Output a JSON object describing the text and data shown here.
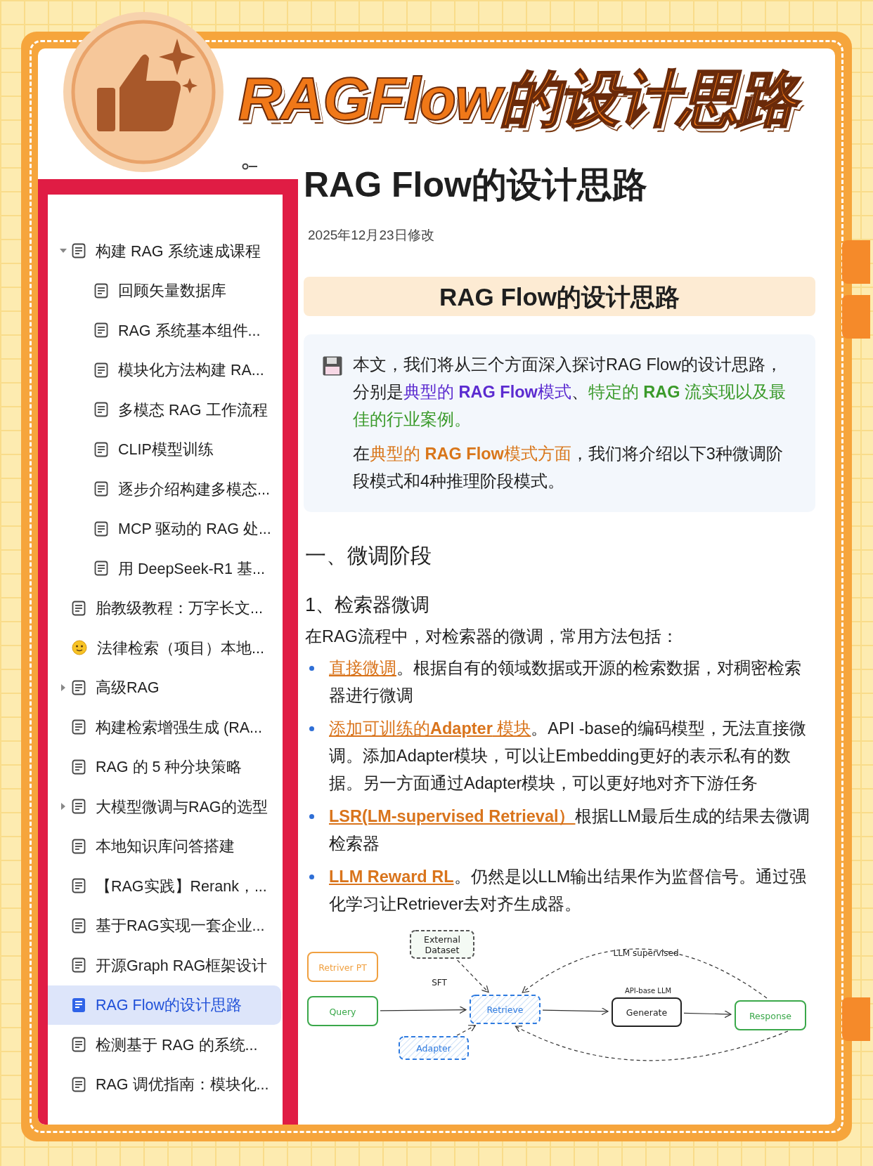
{
  "header": {
    "title": "RAGFlow的设计思路"
  },
  "sidebar": {
    "items": [
      {
        "label": "构建 RAG 系统速成课程",
        "kind": "doc",
        "expanded": true,
        "selected": false,
        "children": [
          {
            "label": "回顾矢量数据库",
            "kind": "doc",
            "selected": false
          },
          {
            "label": "RAG 系统基本组件...",
            "kind": "doc",
            "selected": false
          },
          {
            "label": "模块化方法构建 RA...",
            "kind": "doc",
            "selected": false
          },
          {
            "label": "多模态 RAG 工作流程",
            "kind": "doc",
            "selected": false
          },
          {
            "label": "CLIP模型训练",
            "kind": "doc",
            "selected": false
          },
          {
            "label": "逐步介绍构建多模态...",
            "kind": "doc",
            "selected": false
          },
          {
            "label": "MCP 驱动的 RAG 处...",
            "kind": "doc",
            "selected": false
          },
          {
            "label": "用 DeepSeek-R1 基...",
            "kind": "doc",
            "selected": false
          }
        ]
      },
      {
        "label": "胎教级教程：万字长文...",
        "kind": "doc",
        "selected": false
      },
      {
        "label": "法律检索（项目）本地...",
        "kind": "emoji",
        "selected": false
      },
      {
        "label": "高级RAG",
        "kind": "doc",
        "expanded": false,
        "selected": false
      },
      {
        "label": "构建检索增强生成 (RA...",
        "kind": "doc",
        "selected": false
      },
      {
        "label": "RAG 的 5 种分块策略",
        "kind": "doc",
        "selected": false
      },
      {
        "label": "大模型微调与RAG的选型",
        "kind": "doc",
        "expanded": false,
        "selected": false
      },
      {
        "label": "本地知识库问答搭建",
        "kind": "doc",
        "selected": false
      },
      {
        "label": "【RAG实践】Rerank，...",
        "kind": "doc",
        "selected": false
      },
      {
        "label": "基于RAG实现一套企业...",
        "kind": "doc",
        "selected": false
      },
      {
        "label": "开源Graph RAG框架设计",
        "kind": "doc",
        "selected": false
      },
      {
        "label": "RAG Flow的设计思路",
        "kind": "doc",
        "selected": true
      },
      {
        "label": "检测基于 RAG 的系统...",
        "kind": "doc",
        "selected": false
      },
      {
        "label": "RAG 调优指南：模块化...",
        "kind": "doc",
        "selected": false
      }
    ]
  },
  "document": {
    "title": "RAG Flow的设计思路",
    "modified": "2025年12月23日修改",
    "banner": "RAG Flow的设计思路",
    "callout": [
      [
        {
          "text": "本文，我们将从三个方面深入探讨RAG Flow的设计思路，分别是"
        },
        {
          "text": "典型的 **RAG Flow**模式",
          "color": "#5b2bd0"
        },
        {
          "text": "、"
        },
        {
          "text": "特定的 **RAG** 流实现以及最佳的行业案例。",
          "color": "#3a9a2a"
        }
      ],
      [
        {
          "text": "在"
        },
        {
          "text": "典型的 **RAG Flow**模式方面",
          "color": "#d9761a"
        },
        {
          "text": "，我们将介绍以下3种微调阶段模式和4种推理阶段模式。"
        }
      ]
    ],
    "heading_1": "一、微调阶段",
    "heading_2": "1、检索器微调",
    "intro": "在RAG流程中，对检索器的微调，常用方法包括：",
    "bullets": [
      {
        "link": "直接微调",
        "text": "。根据自有的领域数据或开源的检索数据，对稠密检索器进行微调"
      },
      {
        "link": "添加可训练的**Adapter** 模块",
        "text": "。API -base的编码模型，无法直接微调。添加Adapter模块，可以让Embedding更好的表示私有的数据。另一方面通过Adapter模块，可以更好地对齐下游任务"
      },
      {
        "link": "**LSR(LM-supervised Retrieval）**",
        "text": "根据LLM最后生成的结果去微调检索器"
      },
      {
        "link": "**LLM Reward RL**",
        "text": "。仍然是以LLM输出结果作为监督信号。通过强化学习让Retriever去对齐生成器。"
      }
    ],
    "diagram": {
      "nodes": [
        {
          "label": "Retriver PT",
          "kind": "solid",
          "color": "#f0a040"
        },
        {
          "label": "Query",
          "kind": "solid",
          "color": "#3aa84a"
        },
        {
          "label": "External Dataset",
          "kind": "dashed",
          "color": "#555555"
        },
        {
          "label": "Retrieve",
          "kind": "hatched",
          "color": "#2f7be0"
        },
        {
          "label": "Adapter",
          "kind": "hatched",
          "color": "#2f7be0"
        },
        {
          "label": "Generate",
          "kind": "solid",
          "color": "#222222"
        },
        {
          "label": "Response",
          "kind": "solid",
          "color": "#3aa84a"
        }
      ],
      "labels": [
        "SFT",
        "LLM supervised",
        "API-base LLM"
      ]
    }
  }
}
